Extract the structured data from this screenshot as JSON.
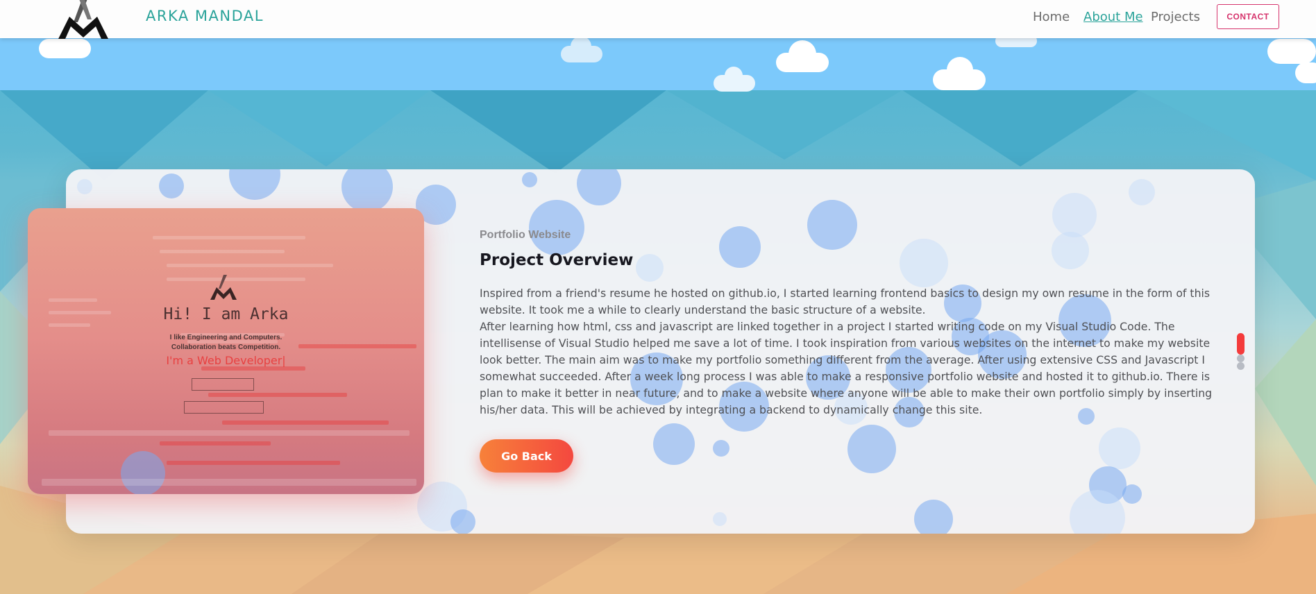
{
  "navbar": {
    "brand": "ARKA MANDAL",
    "links": [
      {
        "label": "Home",
        "active": false
      },
      {
        "label": "About Me",
        "active": true
      },
      {
        "label": "Projects",
        "active": false
      }
    ],
    "contact_label": "CONTACT"
  },
  "project": {
    "overline": "Portfolio Website",
    "title": "Project Overview",
    "paragraph_1": "Inspired from a friend's resume he hosted on github.io, I started learning frontend basics to design my own resume in the form of this website. It took me a while to clearly understand the basic structure of a website.",
    "paragraph_2": "After learning how html, css and javascript are linked together in a project I started writing code on my Visual Studio Code. The intellisense of Visual Studio helped me save a lot of time. I took inspiration from various websites on the internet to make my website look better. The main aim was to make my portfolio something different from the average. After using extensive CSS and Javascript I somewhat succeeded. After a week long process I was able to make a responsive portfolio website and hosted it to github.io. There is plan to make it better in near future, and to make a website where anyone will be able to make their own portfolio simply by inserting his/her data. This will be achieved by integrating a backend to dynamically change this site.",
    "go_back_label": "Go Back"
  },
  "screenshot": {
    "heading": "Hi! I am Arka",
    "line_1": "I like Engineering and Computers.",
    "line_2": "Collaboration beats Competition.",
    "tagline": "I'm a Web Developer|"
  },
  "colors": {
    "accent_teal": "#2aa39a",
    "contact_pink": "#d6336c",
    "button_orange": "#f7813a",
    "button_red": "#f4483f"
  }
}
